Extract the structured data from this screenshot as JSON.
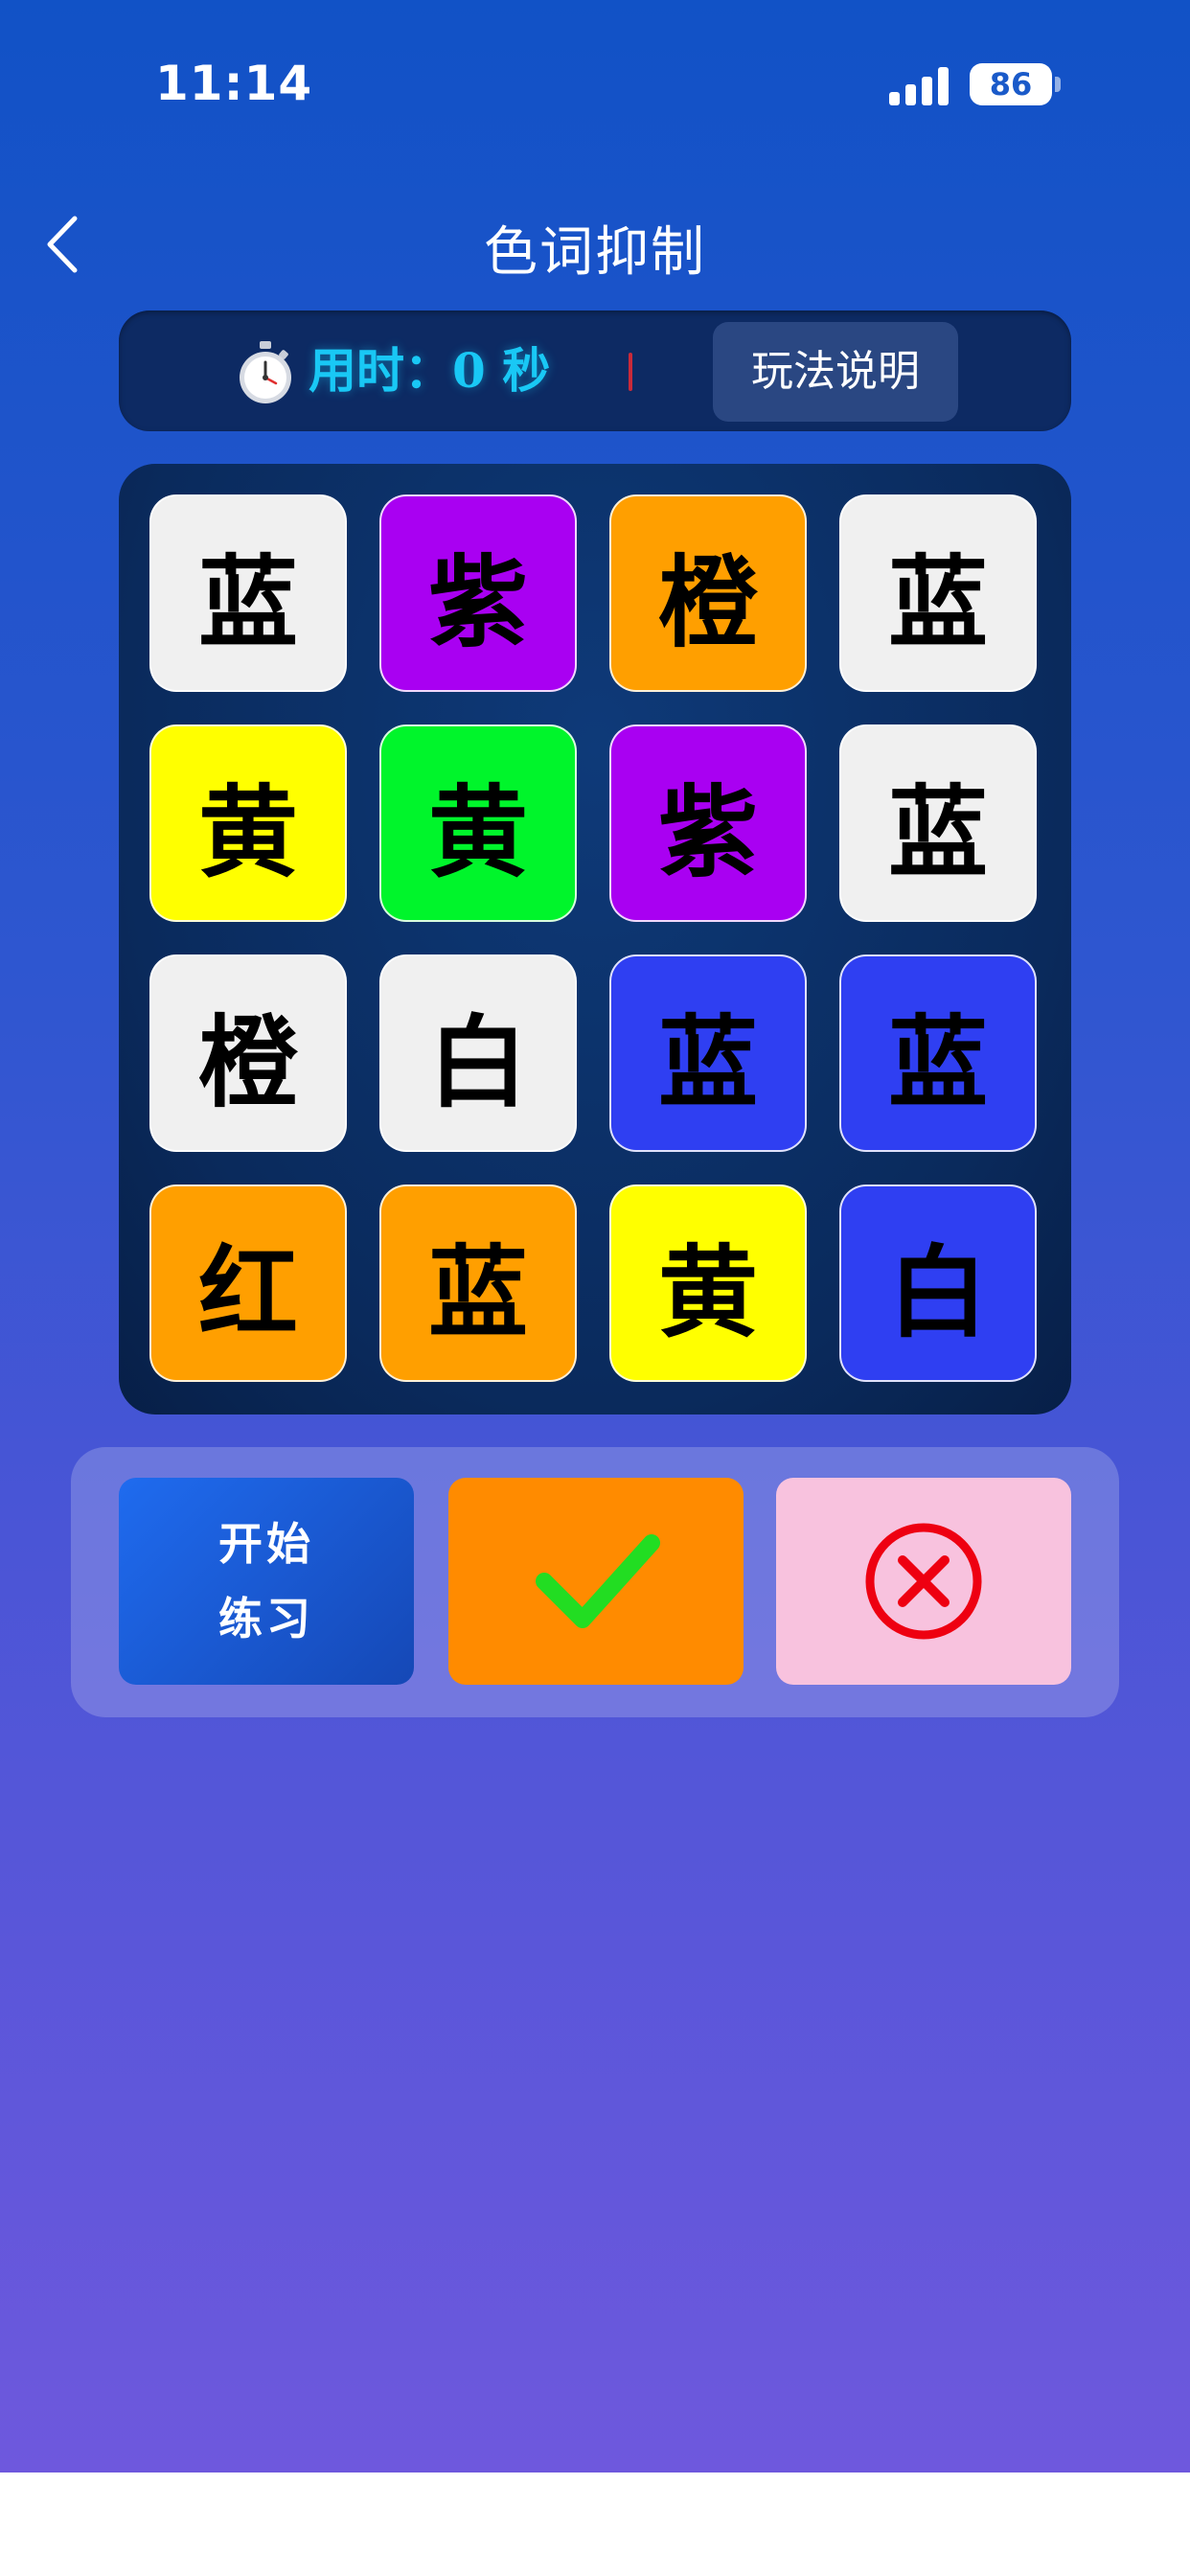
{
  "status_bar": {
    "time": "11:14",
    "battery": "86"
  },
  "nav": {
    "title": "色词抑制"
  },
  "timer": {
    "label": "用时：",
    "value": "0",
    "unit": "秒",
    "rules_label": "玩法说明"
  },
  "grid": {
    "tiles": [
      {
        "text": "蓝",
        "color": "#f0f0f0"
      },
      {
        "text": "紫",
        "color": "#a900f2"
      },
      {
        "text": "橙",
        "color": "#ff9f00"
      },
      {
        "text": "蓝",
        "color": "#f0f0f0"
      },
      {
        "text": "黄",
        "color": "#ffff00"
      },
      {
        "text": "黄",
        "color": "#00f52b"
      },
      {
        "text": "紫",
        "color": "#a900f2"
      },
      {
        "text": "蓝",
        "color": "#f0f0f0"
      },
      {
        "text": "橙",
        "color": "#f0f0f0"
      },
      {
        "text": "白",
        "color": "#f0f0f0"
      },
      {
        "text": "蓝",
        "color": "#2f3ff2"
      },
      {
        "text": "蓝",
        "color": "#2f3ff2"
      },
      {
        "text": "红",
        "color": "#ff9f00"
      },
      {
        "text": "蓝",
        "color": "#ff9f00"
      },
      {
        "text": "黄",
        "color": "#ffff00"
      },
      {
        "text": "白",
        "color": "#2f3ff2"
      }
    ]
  },
  "controls": {
    "start_line1": "开始",
    "start_line2": "练习",
    "confirm_icon": "check-icon",
    "reject_icon": "close-circle-icon"
  },
  "colors": {
    "accent_cyan": "#19c8f5",
    "confirm_orange": "#ff8b00",
    "reject_pink": "#f8c2de",
    "check_green": "#22dd22",
    "reject_red": "#ee0011"
  }
}
